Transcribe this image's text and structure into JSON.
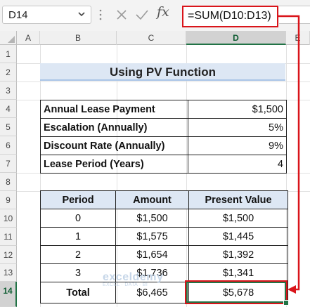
{
  "formula_bar": {
    "name_box": "D14",
    "fx_label": "fx",
    "formula": "=SUM(D10:D13)"
  },
  "columns": [
    "A",
    "B",
    "C",
    "D",
    "E"
  ],
  "rows": [
    "1",
    "2",
    "3",
    "4",
    "5",
    "6",
    "7",
    "8",
    "9",
    "10",
    "11",
    "12",
    "13",
    "14"
  ],
  "title": "Using PV Function",
  "inputs": [
    {
      "label": "Annual Lease Payment",
      "value": "$1,500"
    },
    {
      "label": "Escalation (Annually)",
      "value": "5%"
    },
    {
      "label": "Discount Rate (Annually)",
      "value": "9%"
    },
    {
      "label": "Lease Period (Years)",
      "value": "4"
    }
  ],
  "schedule": {
    "headers": [
      "Period",
      "Amount",
      "Present Value"
    ],
    "rows": [
      [
        "0",
        "$1,500",
        "$1,500"
      ],
      [
        "1",
        "$1,575",
        "$1,445"
      ],
      [
        "2",
        "$1,654",
        "$1,392"
      ],
      [
        "3",
        "$1,736",
        "$1,341"
      ]
    ],
    "total": [
      "Total",
      "$6,465",
      "$5,678"
    ]
  },
  "watermark": {
    "brand": "exceldemy",
    "tagline": "EXCEL · DATA · BI"
  },
  "colors": {
    "highlight_red": "#d9141a",
    "excel_green": "#217346",
    "header_blue": "#dde7f4"
  }
}
